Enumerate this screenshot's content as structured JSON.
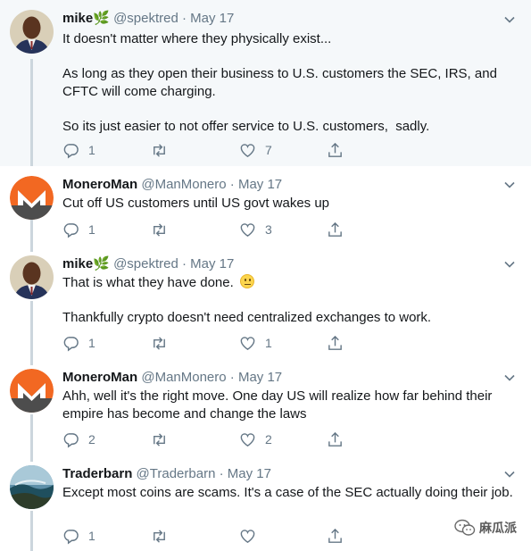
{
  "tweets": [
    {
      "name": "mike",
      "name_suffix": "🌿",
      "handle": "@spektred",
      "date": "· May 17",
      "text": "It doesn't matter where they physically exist...\n\nAs long as they open their business to U.S. customers the SEC, IRS, and CFTC will come charging.\n\nSo its just easier to not offer service to U.S. customers,  sadly.",
      "replies": "1",
      "retweets": "",
      "likes": "7",
      "avatar": "person-avatar"
    },
    {
      "name": "MoneroMan",
      "name_suffix": "",
      "handle": "@ManMonero",
      "date": "· May 17",
      "text": "Cut off US customers until US govt wakes up",
      "replies": "1",
      "retweets": "",
      "likes": "3",
      "avatar": "monero-logo-avatar"
    },
    {
      "name": "mike",
      "name_suffix": "🌿",
      "handle": "@spektred",
      "date": "· May 17",
      "text": "That is what they have done.",
      "text2": "Thankfully crypto doesn't need centralized exchanges to work.",
      "replies": "1",
      "retweets": "",
      "likes": "1",
      "avatar": "person-avatar"
    },
    {
      "name": "MoneroMan",
      "name_suffix": "",
      "handle": "@ManMonero",
      "date": "· May 17",
      "text": "Ahh, well it's the right move. One day US will realize how far behind their empire has become and change the laws",
      "replies": "2",
      "retweets": "",
      "likes": "2",
      "avatar": "monero-logo-avatar"
    },
    {
      "name": "Traderbarn",
      "name_suffix": "",
      "handle": "@Traderbarn",
      "date": "· May 17",
      "text": "Except most coins are scams. It's a case of the SEC actually doing their job.",
      "replies": "1",
      "retweets": "",
      "likes": "",
      "avatar": "landscape-avatar"
    }
  ],
  "watermark": {
    "text": "麻瓜派",
    "icon": "wechat-icon"
  },
  "colors": {
    "icon_gray": "#657786",
    "monero_orange": "#f26822",
    "monero_gray": "#4d4d4d",
    "highlight_bg": "#f5f8fa",
    "thread_line": "#ccd6dd"
  }
}
